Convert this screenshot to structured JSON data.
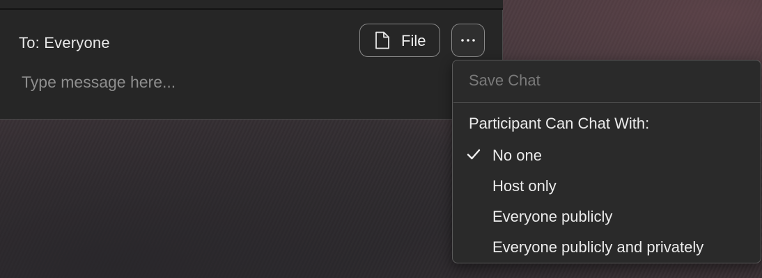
{
  "chat": {
    "to_label": "To: Everyone",
    "file_button_label": "File",
    "message_placeholder": "Type message here..."
  },
  "menu": {
    "save_chat_label": "Save Chat",
    "section_header": "Participant Can Chat With:",
    "options": [
      {
        "label": "No one",
        "checked": true
      },
      {
        "label": "Host only",
        "checked": false
      },
      {
        "label": "Everyone publicly",
        "checked": false
      },
      {
        "label": "Everyone publicly and privately",
        "checked": false
      }
    ]
  },
  "icons": {
    "file": "file-icon",
    "more": "ellipsis-icon",
    "check": "checkmark-icon"
  },
  "colors": {
    "panel_bg": "#262626",
    "menu_bg": "#2a2a2a",
    "text": "#ececec",
    "disabled_text": "#7a7a7a",
    "placeholder": "#8e8e8e"
  }
}
